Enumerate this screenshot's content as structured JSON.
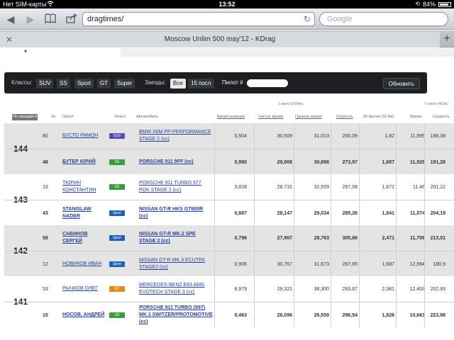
{
  "statusbar": {
    "carrier": "Нет SIM-карты",
    "time": "13:52",
    "battery": "84%",
    "battery_level": 0.84
  },
  "browser": {
    "url": "dragtimes/",
    "search_placeholder": "Google",
    "tab_title": "Moscow Unlim 500 may'12 - KDrag"
  },
  "filter": {
    "classes_label": "Классы:",
    "classes": [
      "SUV",
      "SS",
      "Sport",
      "GT",
      "Super"
    ],
    "runs_label": "Заезды:",
    "runs": [
      "Все",
      "15 посл"
    ],
    "runs_active": "Все",
    "pilot_label": "Пилот #",
    "refresh_label": "Обновить"
  },
  "table": {
    "sort_label": "По заездам",
    "subheader_mile": "1 мили (1609м)",
    "subheader_quarter": "¼ мили (402м)",
    "columns": {
      "num": "№",
      "pilot": "Пилот",
      "klass": "Класс",
      "car": "Автомобиль",
      "reaction": "Время реакции",
      "clean": "Чистое время",
      "dirty": "Грязное время",
      "speed": "Скорость",
      "ft60": "60 футов (18.3м)",
      "time": "Время",
      "speed2": "Скорость"
    },
    "class_colors": {
      "SUV": "#5a4fb0",
      "SS": "#3f9a3f",
      "Sport": "#1f5fb8",
      "GT": "#e08a1a"
    },
    "groups": [
      {
        "place": "144",
        "rows": [
          {
            "num": "80",
            "pilot": "БУСТО РАМОН",
            "klass": "SUV",
            "car": "BMW X6M PP-PERFORMANCE STAGE 2 (cc)",
            "reaction": "0,504",
            "clean": "30,509",
            "dirty": "31,013",
            "speed": "265,09",
            "ft60": "1,82",
            "time": "11,995",
            "speed2": "188,38",
            "winner": false
          },
          {
            "num": "48",
            "pilot": "БУТЕР ЮРИЙ",
            "klass": "SS",
            "car": "PORSCHE 911 9FF (cc)",
            "reaction": "0,990",
            "clean": "29,908",
            "dirty": "30,898",
            "speed": "273,97",
            "ft60": "1,887",
            "time": "11,928",
            "speed2": "191,28",
            "winner": true
          }
        ]
      },
      {
        "place": "143",
        "rows": [
          {
            "num": "19",
            "pilot": "ТЮРИН КОНСТАНТИН",
            "klass": "SS",
            "car": "PORSCHE 911 TURBO 977 POK STAGE 2 (cc)",
            "reaction": "3,828",
            "clean": "28,731",
            "dirty": "32,559",
            "speed": "287,08",
            "ft60": "1,872",
            "time": "11,46",
            "speed2": "201,22",
            "winner": false
          },
          {
            "num": "43",
            "pilot": "STANISLAW NADER",
            "klass": "Sport",
            "car": "NISSAN GT-R HKS GT600R (cc)",
            "reaction": "0,887",
            "clean": "28,147",
            "dirty": "29,034",
            "speed": "285,26",
            "ft60": "1,841",
            "time": "11,074",
            "speed2": "204,19",
            "winner": true
          }
        ]
      },
      {
        "place": "142",
        "rows": [
          {
            "num": "58",
            "pilot": "САВИНОВ СЕРГЕЙ",
            "klass": "Sport",
            "car": "NISSAN GT-R MK.2 SPE STAGE 2 (cc)",
            "reaction": "0,796",
            "clean": "27,967",
            "dirty": "28,763",
            "speed": "305,86",
            "ft60": "2,471",
            "time": "11,706",
            "speed2": "213,01",
            "winner": true
          },
          {
            "num": "12",
            "pilot": "НОВИКОВ ИВАН",
            "klass": "Sport",
            "car": "NISSAN GT-R MK.3 ECUTEK STAGE2 (cc)",
            "reaction": "0,906",
            "clean": "30,767",
            "dirty": "31,673",
            "speed": "267,85",
            "ft60": "1,687",
            "time": "12,994",
            "speed2": "180,9",
            "winner": false
          }
        ]
      },
      {
        "place": "141",
        "rows": [
          {
            "num": "53",
            "pilot": "РЫЧКОВ ОЛЕГ",
            "klass": "GT",
            "car": "MERCEDES-BENZ E63 AMG EVOTECH STAGE 3 (cc)",
            "reaction": "8,979",
            "clean": "29,321",
            "dirty": "38,300",
            "speed": "293,67",
            "ft60": "2,381",
            "time": "12,403",
            "speed2": "202,93",
            "winner": false
          },
          {
            "num": "15",
            "pilot": "НОСОВ, АНДРЕЙ",
            "klass": "SS",
            "car": "PORSCHE 911 TURBO (997) MK.1 SWITZER/PROTOMOTIVE (cc)",
            "reaction": "0,463",
            "clean": "26,096",
            "dirty": "26,559",
            "speed": "296,54",
            "ft60": "1,826",
            "time": "10,663",
            "speed2": "223,88",
            "winner": true
          }
        ]
      }
    ]
  }
}
